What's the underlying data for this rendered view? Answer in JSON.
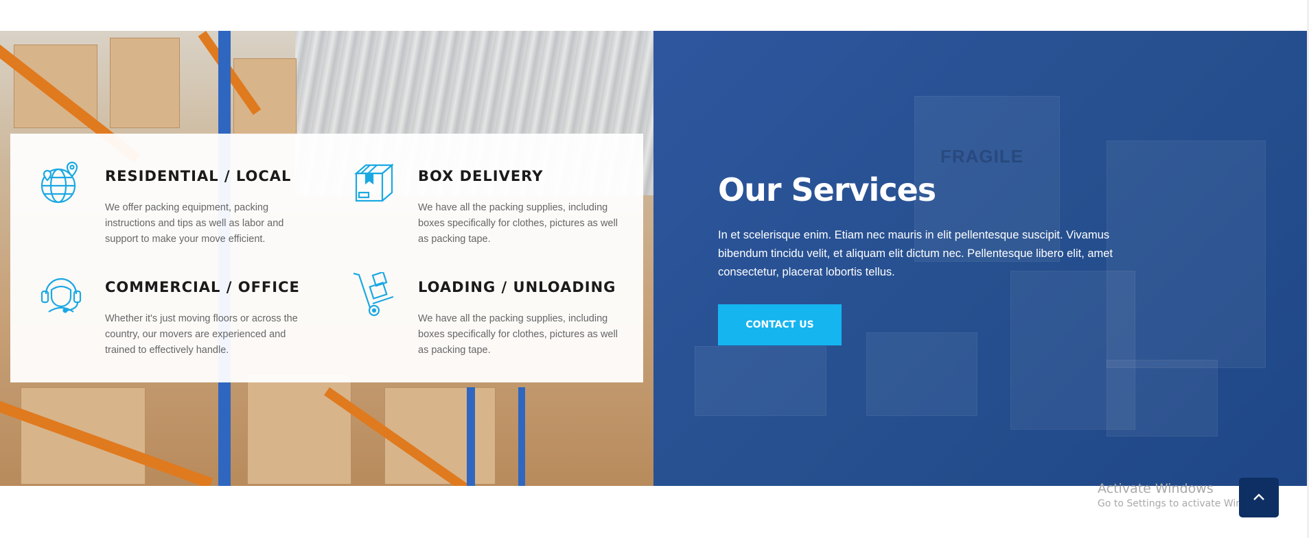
{
  "services": [
    {
      "icon": "globe-pin-icon",
      "title": "RESIDENTIAL / LOCAL",
      "text": "We offer packing equipment, packing instructions and tips as well as labor and support to make your move efficient."
    },
    {
      "icon": "box-icon",
      "title": "BOX DELIVERY",
      "text": "We have all the packing supplies, including boxes specifically for clothes, pictures as well as packing tape."
    },
    {
      "icon": "headset-icon",
      "title": "COMMERCIAL / OFFICE",
      "text": "Whether it's just moving floors or across the country, our movers are experienced and trained to effectively handle."
    },
    {
      "icon": "hand-truck-icon",
      "title": "LOADING / UNLOADING",
      "text": "We have all the packing supplies, including boxes specifically for clothes, pictures as well as packing tape."
    }
  ],
  "intro": {
    "title": "Our Services",
    "text": "In et scelerisque enim. Etiam nec mauris in elit pellentesque suscipit. Vivamus bibendum tincidu velit, et aliquam elit dictum nec. Pellentesque libero elit, amet consectetur, placerat lobortis tellus.",
    "button_label": "CONTACT US",
    "background_text": "FRAGILE"
  },
  "watermark": {
    "title": "Activate Windows",
    "subtitle": "Go to Settings to activate Windows."
  },
  "scroll_top_icon": "chevron-up-icon",
  "colors": {
    "accent": "#15b5f0",
    "panel_blue": "#26508f",
    "scroll_button": "#0d2f63",
    "icon": "#1aa8e3"
  }
}
